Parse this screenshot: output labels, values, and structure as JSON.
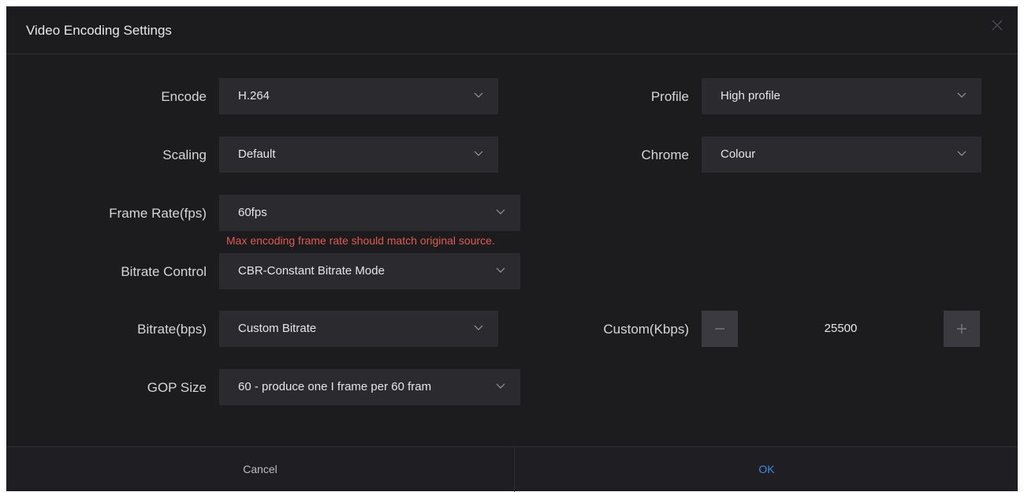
{
  "dialog": {
    "title": "Video Encoding Settings",
    "close_icon": "close-icon"
  },
  "fields": {
    "encode": {
      "label": "Encode",
      "value": "H.264"
    },
    "profile": {
      "label": "Profile",
      "value": "High profile"
    },
    "scaling": {
      "label": "Scaling",
      "value": "Default"
    },
    "chrome": {
      "label": "Chrome",
      "value": "Colour"
    },
    "frame_rate": {
      "label": "Frame Rate(fps)",
      "value": "60fps",
      "warning": "Max encoding frame rate should match original source."
    },
    "bitrate_control": {
      "label": "Bitrate Control",
      "value": "CBR-Constant Bitrate Mode"
    },
    "bitrate": {
      "label": "Bitrate(bps)",
      "value": "Custom Bitrate"
    },
    "custom_kbps": {
      "label": "Custom(Kbps)",
      "value": "25500"
    },
    "gop_size": {
      "label": "GOP Size",
      "value": "60 - produce one I frame per 60 fram"
    }
  },
  "footer": {
    "cancel_label": "Cancel",
    "ok_label": "OK"
  },
  "colors": {
    "background": "#1c1c1f",
    "input": "#2a2a2f",
    "warning": "#e05a4f",
    "accent": "#3d8de8"
  }
}
